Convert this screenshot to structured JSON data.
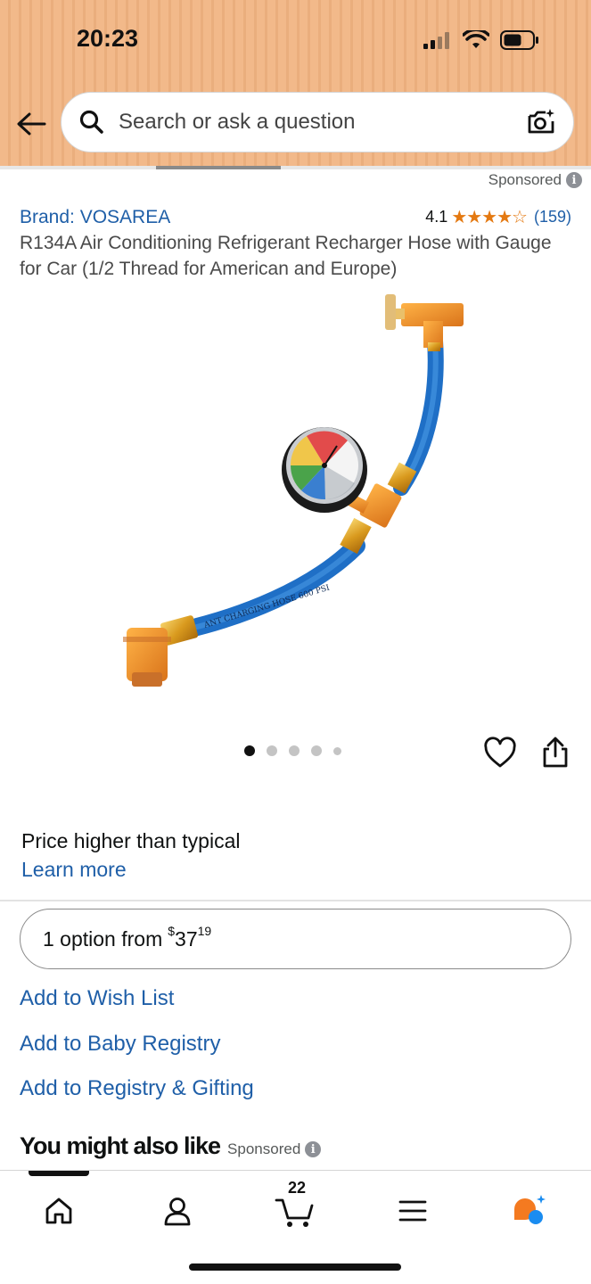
{
  "status_bar": {
    "time": "20:23"
  },
  "search": {
    "placeholder": "Search or ask a question"
  },
  "product": {
    "sponsored": "Sponsored",
    "brand": "Brand: VOSAREA",
    "rating": "4.1",
    "rating_value": 4.1,
    "stars": "★★★★☆",
    "review_count": "(159)",
    "title": "R134A Air Conditioning Refrigerant Recharger Hose with Gauge for Car (1/2 Thread for American and Europe)",
    "image_hose_text": "ANT CHARGING HOSE 600 PSI",
    "image_count": 5,
    "active_image": 1
  },
  "pricing": {
    "note": "Price higher than typical",
    "learn_more": "Learn more",
    "option_prefix": "1 option from",
    "currency": "$",
    "price_whole": "37",
    "price_fraction": "19"
  },
  "actions": {
    "wish_list": "Add to Wish List",
    "baby_registry": "Add to Baby Registry",
    "registry_gifting": "Add to Registry & Gifting"
  },
  "recommendations": {
    "heading": "You might also like",
    "sponsored": "Sponsored"
  },
  "bottom_nav": {
    "items": [
      "home-icon",
      "account-icon",
      "cart-icon",
      "menu-icon",
      "rufus-icon"
    ],
    "cart_count": "22"
  },
  "colors": {
    "link": "#1f5fa8",
    "star": "#e47911",
    "header_bg": "#f2b98a",
    "rufus_orange": "#f47a20",
    "rufus_blue": "#1a8cf0"
  }
}
